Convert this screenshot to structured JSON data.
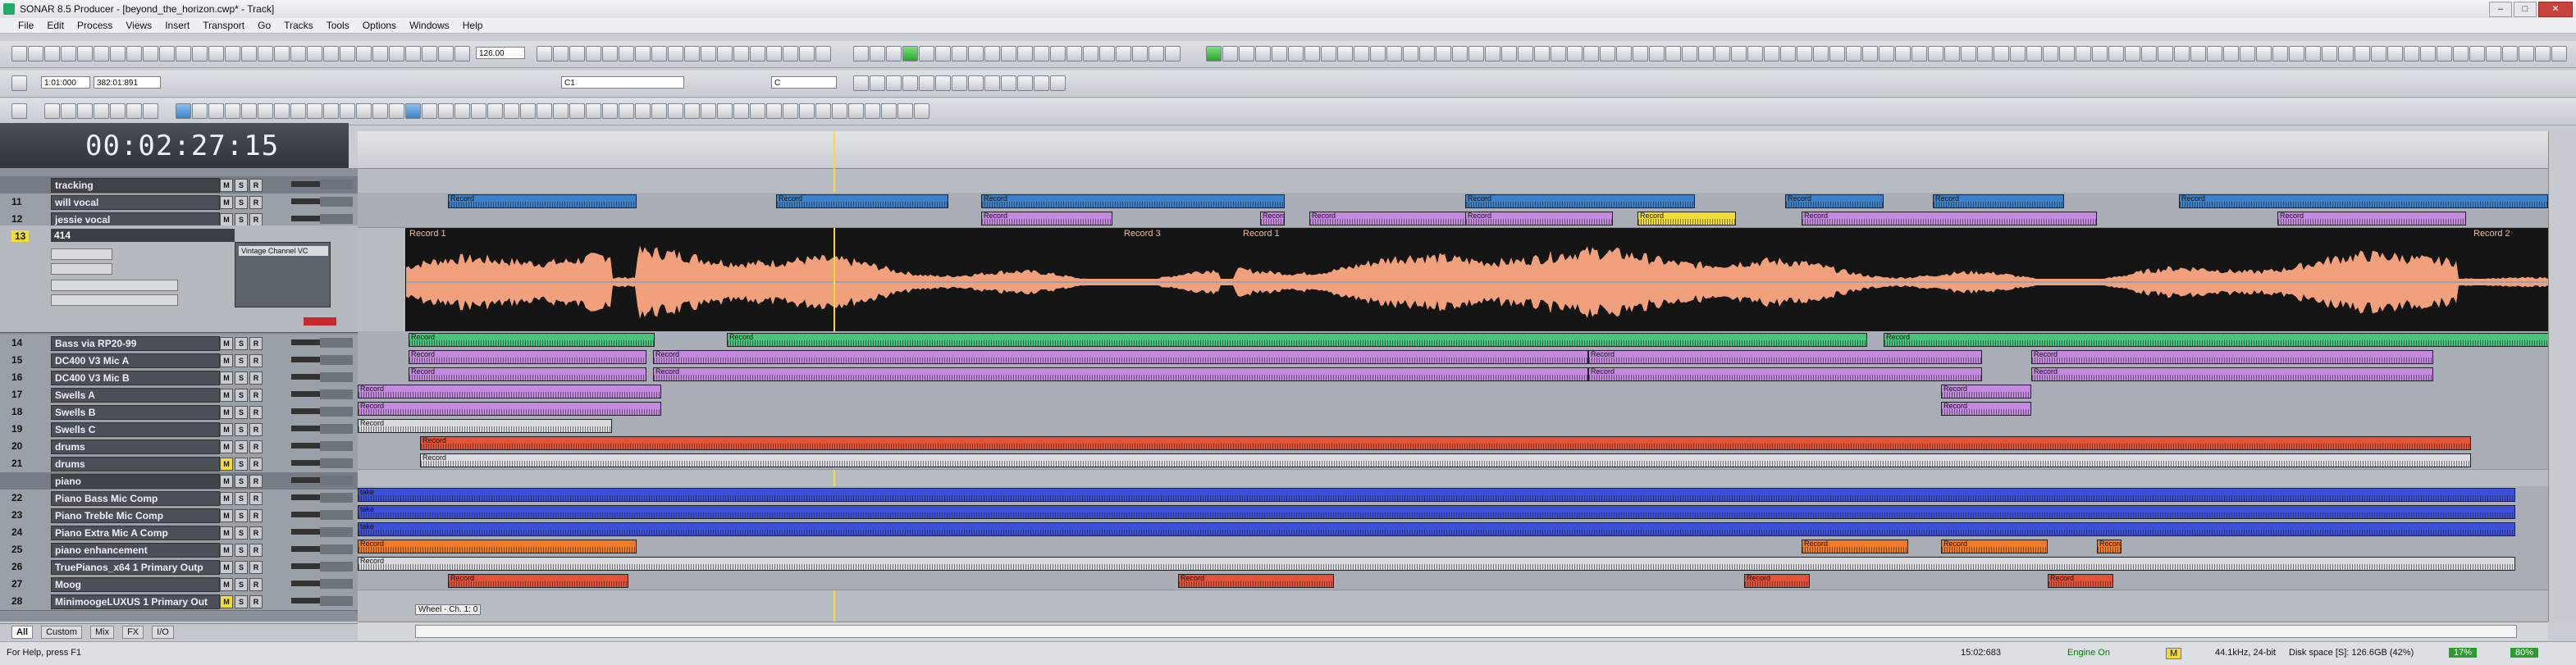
{
  "window": {
    "title": "SONAR 8.5 Producer - [beyond_the_horizon.cwp* - Track]"
  },
  "menu": [
    "File",
    "Edit",
    "Process",
    "Views",
    "Insert",
    "Transport",
    "Go",
    "Tracks",
    "Tools",
    "Options",
    "Windows",
    "Help"
  ],
  "toolbar": {
    "tempo": "126.00",
    "time_start": "1:01:000",
    "time_end": "382:01:891",
    "track_select": "C1",
    "key_select": "C"
  },
  "clock": "00:02:27:15",
  "tracks": [
    {
      "num": "",
      "name": "tracking",
      "kind": "folder"
    },
    {
      "num": "11",
      "name": "will vocal"
    },
    {
      "num": "12",
      "name": "jessie vocal"
    },
    {
      "num": "14",
      "name": "Bass via RP20-99"
    },
    {
      "num": "15",
      "name": "DC400 V3 Mic A"
    },
    {
      "num": "16",
      "name": "DC400 V3 Mic B"
    },
    {
      "num": "17",
      "name": "Swells A"
    },
    {
      "num": "18",
      "name": "Swells B"
    },
    {
      "num": "19",
      "name": "Swells C"
    },
    {
      "num": "20",
      "name": "drums"
    },
    {
      "num": "21",
      "name": "drums"
    },
    {
      "num": "",
      "name": "piano",
      "kind": "folder"
    },
    {
      "num": "22",
      "name": "Piano Bass Mic Comp"
    },
    {
      "num": "23",
      "name": "Piano Treble Mic Comp"
    },
    {
      "num": "24",
      "name": "Piano Extra Mic A Comp"
    },
    {
      "num": "25",
      "name": "piano enhancement"
    },
    {
      "num": "26",
      "name": "TruePianos_x64 1 Primary Outp"
    },
    {
      "num": "27",
      "name": "Moog"
    },
    {
      "num": "28",
      "name": "MinimoogeLUXUS 1 Primary Out"
    }
  ],
  "selected_track": {
    "num": "13",
    "name": "414",
    "fx": "Vintage Channel VC"
  },
  "big_clip_labels": [
    "Record 1",
    "Record 3",
    "Record 1",
    "Record 2"
  ],
  "clip_labels": {
    "record": "Record",
    "take": "take",
    "dub": "dub"
  },
  "wheel_label": "Wheel - Ch. 1: 0",
  "tabs": [
    "All",
    "Custom",
    "Mix",
    "FX",
    "I/O"
  ],
  "status": {
    "help": "For Help, press F1",
    "time": "15:02:683",
    "engine": "Engine On",
    "m": "M",
    "format": "44.1kHz, 24-bit",
    "disk": "Disk space [S]: 126.6GB (42%)",
    "cpu": "17%",
    "disk_pct": "80%"
  },
  "colors": {
    "accent": "#2aa52a",
    "record": "#f2dc3a",
    "wave": "#f0a07a",
    "vocal": "#3d82c8",
    "purple": "#c48adf",
    "green": "#49c27a",
    "red": "#e0523a",
    "piano": "#3c4fd6",
    "orange": "#f07a2a"
  }
}
